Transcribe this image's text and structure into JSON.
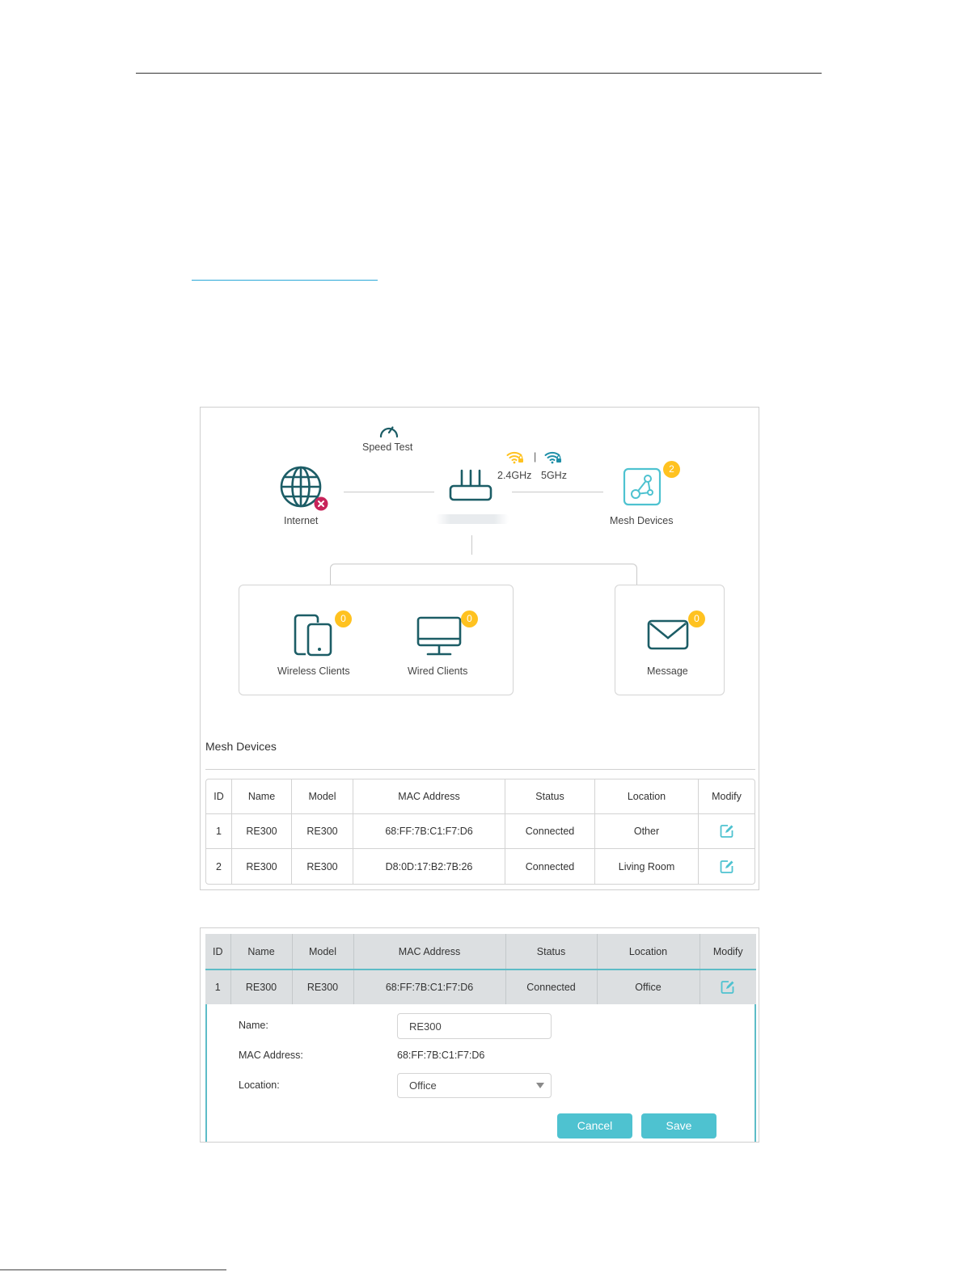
{
  "dashboard": {
    "speed_test_label": "Speed Test",
    "internet_label": "Internet",
    "band_24_label": "2.4GHz",
    "band_separator": "|",
    "band_5_label": "5GHz",
    "mesh_devices_label": "Mesh Devices",
    "mesh_devices_count": "2",
    "wireless_clients_label": "Wireless Clients",
    "wireless_clients_count": "0",
    "wired_clients_label": "Wired Clients",
    "wired_clients_count": "0",
    "message_label": "Message",
    "message_count": "0"
  },
  "mesh_table": {
    "section_title": "Mesh Devices",
    "columns": [
      "ID",
      "Name",
      "Model",
      "MAC Address",
      "Status",
      "Location",
      "Modify"
    ],
    "rows": [
      {
        "id": "1",
        "name": "RE300",
        "model": "RE300",
        "mac": "68:FF:7B:C1:F7:D6",
        "status": "Connected",
        "location": "Other"
      },
      {
        "id": "2",
        "name": "RE300",
        "model": "RE300",
        "mac": "D8:0D:17:B2:7B:26",
        "status": "Connected",
        "location": "Living Room"
      }
    ]
  },
  "edit_table": {
    "columns": [
      "ID",
      "Name",
      "Model",
      "MAC Address",
      "Status",
      "Location",
      "Modify"
    ],
    "row": {
      "id": "1",
      "name": "RE300",
      "model": "RE300",
      "mac": "68:FF:7B:C1:F7:D6",
      "status": "Connected",
      "location": "Office"
    }
  },
  "edit_form": {
    "name_label": "Name:",
    "name_value": "RE300",
    "mac_label": "MAC Address:",
    "mac_value": "68:FF:7B:C1:F7:D6",
    "location_label": "Location:",
    "location_value": "Office",
    "cancel_label": "Cancel",
    "save_label": "Save"
  },
  "colors": {
    "teal_dark": "#1c5d66",
    "teal_light": "#4ec2d0",
    "badge_yellow": "#ffc220",
    "error_red": "#c8245a",
    "wifi_24_color": "#ffc220",
    "wifi_5_color": "#1f8fa8"
  }
}
